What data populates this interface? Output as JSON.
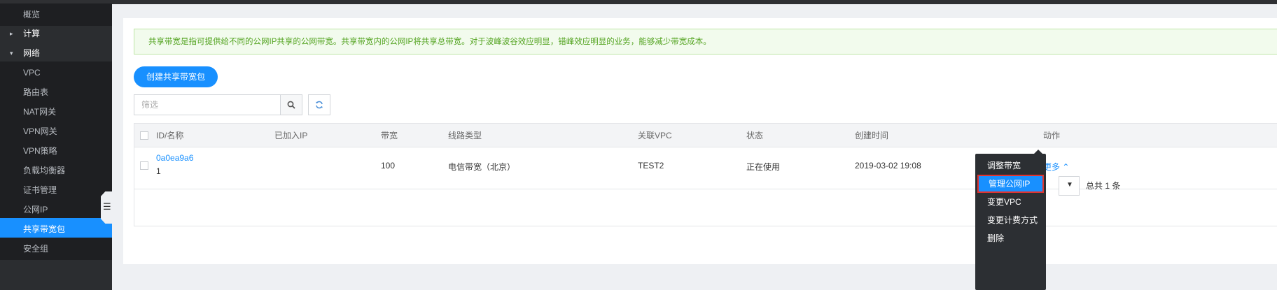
{
  "sidebar": {
    "items": [
      {
        "label": "概览",
        "type": "sub"
      },
      {
        "label": "计算",
        "type": "section",
        "arrow": "collapsed"
      },
      {
        "label": "网络",
        "type": "section",
        "arrow": "expanded"
      },
      {
        "label": "VPC",
        "type": "sub"
      },
      {
        "label": "路由表",
        "type": "sub"
      },
      {
        "label": "NAT网关",
        "type": "sub"
      },
      {
        "label": "VPN网关",
        "type": "sub"
      },
      {
        "label": "VPN策略",
        "type": "sub"
      },
      {
        "label": "负载均衡器",
        "type": "sub"
      },
      {
        "label": "证书管理",
        "type": "sub"
      },
      {
        "label": "公网IP",
        "type": "sub"
      },
      {
        "label": "共享带宽包",
        "type": "active"
      },
      {
        "label": "安全组",
        "type": "sub"
      }
    ],
    "collapse_icon": "list-collapse-icon"
  },
  "notice": {
    "text": "共享带宽是指可提供给不同的公网IP共享的公网带宽。共享带宽内的公网IP将共享总带宽。对于波峰波谷效应明显，错峰效应明显的业务，能够减少带宽成本。"
  },
  "toolbar": {
    "create_label": "创建共享带宽包",
    "search_placeholder": "筛选",
    "search_icon": "search-icon",
    "refresh_icon": "refresh-icon"
  },
  "table": {
    "headers": {
      "id_name": "ID/名称",
      "ips": "已加入IP",
      "bandwidth": "带宽",
      "line_type": "线路类型",
      "vpc": "关联VPC",
      "status": "状态",
      "created": "创建时间",
      "action": "动作"
    },
    "rows": [
      {
        "id": "0a0ea9a6",
        "name": "1",
        "ips": "",
        "bandwidth": "100",
        "line_type": "电信带宽（北京）",
        "vpc": "TEST2",
        "status": "正在使用",
        "created": "2019-03-02 19:08",
        "action": "更多 ⌃"
      }
    ]
  },
  "pager": {
    "total": "总共 1 条"
  },
  "dropdown": {
    "items": [
      "调整带宽",
      "管理公网IP",
      "变更VPC",
      "变更计费方式",
      "删除"
    ],
    "highlighted": "管理公网IP"
  },
  "colors": {
    "accent": "#1890ff",
    "sidebar_bg": "#2b2d30",
    "notice_text": "#52a31f",
    "highlight_border": "#e0332f"
  }
}
